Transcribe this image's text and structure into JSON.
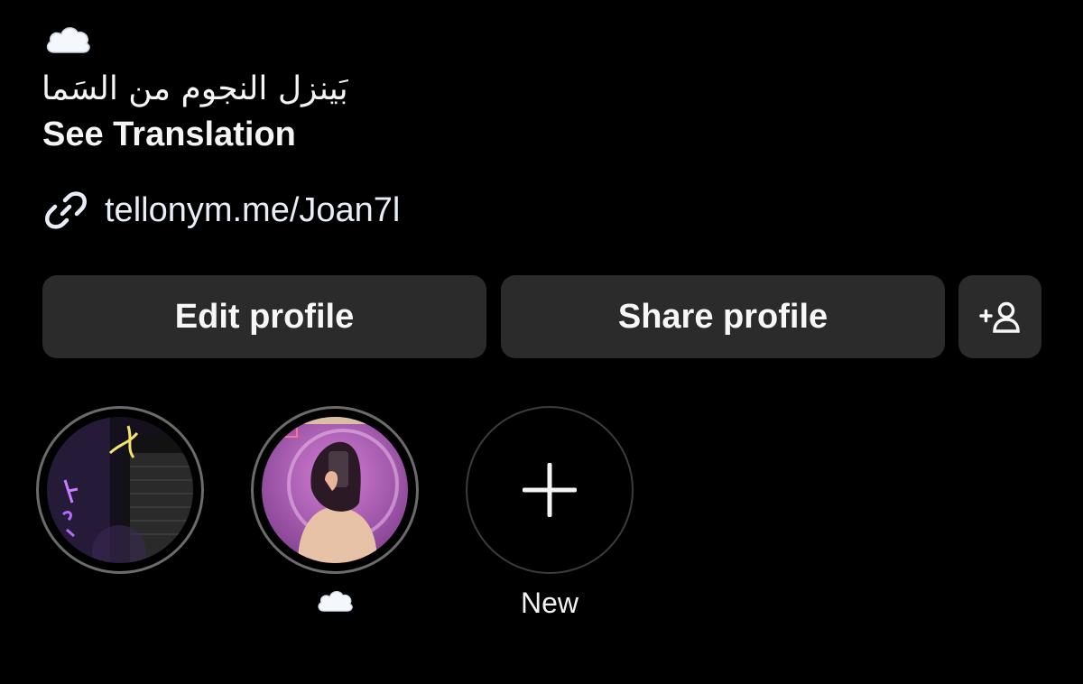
{
  "profile": {
    "bio_emoji": "cloud-emoji",
    "bio_text": "بَينزل النجوم من السَما",
    "see_translation_label": "See Translation",
    "link": {
      "icon": "link-icon",
      "text": "tellonym.me/Joan7l"
    }
  },
  "actions": {
    "edit_profile_label": "Edit profile",
    "share_profile_label": "Share profile",
    "discover_people_icon": "add-person-icon"
  },
  "highlights": [
    {
      "label": "",
      "cover": "neon-pizza-storefront"
    },
    {
      "label": "☁️",
      "cover": "mirror-selfie-pink-light"
    },
    {
      "label": "New",
      "icon": "plus-icon"
    }
  ],
  "colors": {
    "background": "#000000",
    "button_bg": "#2b2b2b",
    "text": "#f5f5f5",
    "ring": "#6b6b6b"
  }
}
